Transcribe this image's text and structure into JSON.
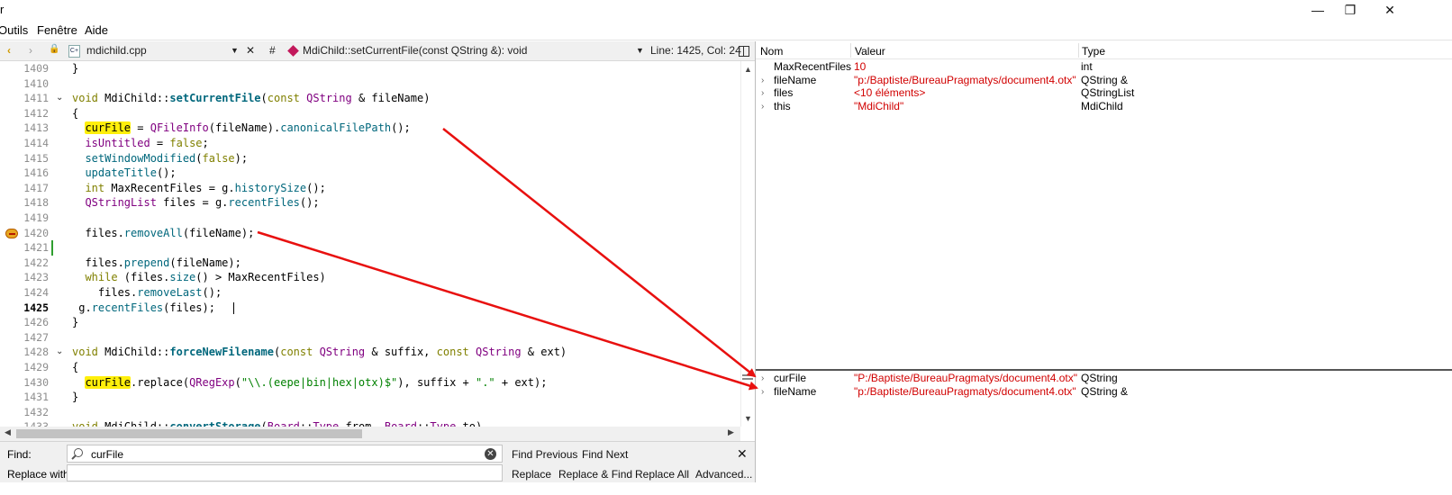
{
  "window": {
    "title_fragment": "r",
    "controls": {
      "minimize": "—",
      "restore": "❐",
      "close": "✕"
    }
  },
  "menu": {
    "items": [
      "Outils",
      "Fenêtre",
      "Aide"
    ]
  },
  "editor_toolbar": {
    "file_name": "mdichild.cpp",
    "hash": "#",
    "symbol": "MdiChild::setCurrentFile(const QString &): void",
    "position": "Line: 1425, Col: 24",
    "split_icon": "split-icon"
  },
  "editor": {
    "current_line": "1425",
    "breakpoint_line": "1420",
    "lines": [
      {
        "n": "1409",
        "html": "}"
      },
      {
        "n": "1410",
        "html": ""
      },
      {
        "n": "1411",
        "html": "<span class=\"kw\">void</span> MdiChild::<span class=\"fnb\">setCurrentFile</span>(<span class=\"kw\">const</span> <span class=\"ty\">QString</span> &amp; fileName)"
      },
      {
        "n": "1412",
        "html": "{"
      },
      {
        "n": "1413",
        "html": "  <span class=\"hl\">curFile</span> = <span class=\"ty\">QFileInfo</span>(fileName).<span class=\"fn\">canonicalFilePath</span>();"
      },
      {
        "n": "1414",
        "html": "  <span class=\"ty\">isUntitled</span> = <span class=\"kw\">false</span>;"
      },
      {
        "n": "1415",
        "html": "  <span class=\"fn\">setWindowModified</span>(<span class=\"kw\">false</span>);"
      },
      {
        "n": "1416",
        "html": "  <span class=\"fn\">updateTitle</span>();"
      },
      {
        "n": "1417",
        "html": "  <span class=\"kw\">int</span> MaxRecentFiles = g.<span class=\"fn\">historySize</span>();"
      },
      {
        "n": "1418",
        "html": "  <span class=\"ty\">QStringList</span> files = g.<span class=\"fn\">recentFiles</span>();"
      },
      {
        "n": "1419",
        "html": ""
      },
      {
        "n": "1420",
        "html": "  files.<span class=\"fn\">removeAll</span>(fileName);"
      },
      {
        "n": "1421",
        "html": ""
      },
      {
        "n": "1422",
        "html": "  files.<span class=\"fn\">prepend</span>(fileName);"
      },
      {
        "n": "1423",
        "html": "  <span class=\"kw\">while</span> (files.<span class=\"fn\">size</span>() &gt; MaxRecentFiles)"
      },
      {
        "n": "1424",
        "html": "    files.<span class=\"fn\">removeLast</span>();"
      },
      {
        "n": "1425",
        "html": " g.<span class=\"fn\">recentFiles</span>(files);"
      },
      {
        "n": "1426",
        "html": "}"
      },
      {
        "n": "1427",
        "html": ""
      },
      {
        "n": "1428",
        "html": "<span class=\"kw\">void</span> MdiChild::<span class=\"fnb\">forceNewFilename</span>(<span class=\"kw\">const</span> <span class=\"ty\">QString</span> &amp; suffix, <span class=\"kw\">const</span> <span class=\"ty\">QString</span> &amp; ext)"
      },
      {
        "n": "1429",
        "html": "{"
      },
      {
        "n": "1430",
        "html": "  <span class=\"hl\">curFile</span>.replace(<span class=\"ty\">QRegExp</span>(<span class=\"str\">\"\\\\.(eepe|bin|hex|otx)$\"</span>), suffix + <span class=\"str\">\".\"</span> + ext);"
      },
      {
        "n": "1431",
        "html": "}"
      },
      {
        "n": "1432",
        "html": ""
      },
      {
        "n": "1433",
        "html": "<span class=\"kw\">void</span> MdiChild::<span class=\"fnb\">convertStorage</span>(<span class=\"ty\">Board</span>::<span class=\"ty\">Type</span> from, <span class=\"ty\">Board</span>::<span class=\"ty\">Type</span> to)"
      }
    ]
  },
  "findbar": {
    "find_label": "Find:",
    "replace_label": "Replace with:",
    "find_value": "curFile",
    "replace_value": "",
    "find_previous": "Find Previous",
    "find_next": "Find Next",
    "replace": "Replace",
    "replace_and_find": "Replace & Find",
    "replace_all": "Replace All",
    "advanced": "Advanced...",
    "close": "✕"
  },
  "locals": {
    "headers": [
      "Nom",
      "Valeur",
      "Type"
    ],
    "rows": [
      {
        "name": "MaxRecentFiles",
        "value": "10",
        "type": "int",
        "expandable": false
      },
      {
        "name": "fileName",
        "value": "\"p:/Baptiste/BureauPragmatys/document4.otx\"",
        "type": "QString &",
        "expandable": true
      },
      {
        "name": "files",
        "value": "<10 éléments>",
        "type": "QStringList",
        "expandable": true
      },
      {
        "name": "this",
        "value": "\"MdiChild\"",
        "type": "MdiChild",
        "expandable": true
      }
    ]
  },
  "watch": {
    "rows": [
      {
        "name": "curFile",
        "value": "\"P:/Baptiste/BureauPragmatys/document4.otx\"",
        "type": "QString",
        "expandable": true
      },
      {
        "name": "fileName",
        "value": "\"p:/Baptiste/BureauPragmatys/document4.otx\"",
        "type": "QString &",
        "expandable": true
      }
    ]
  },
  "colors": {
    "annotation_arrow": "#e8100f",
    "highlight": "#ffef0b",
    "value_red": "#d10000"
  }
}
